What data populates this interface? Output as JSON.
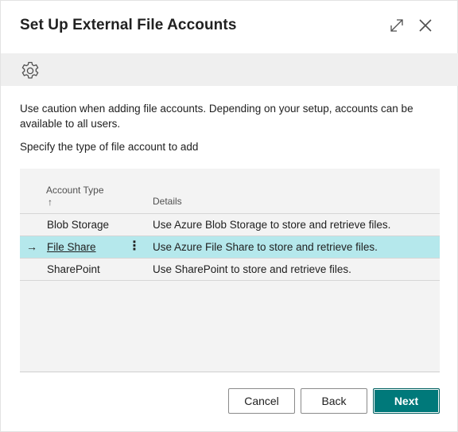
{
  "dialog": {
    "title": "Set Up External File Accounts"
  },
  "icons": {
    "expand": "expand-icon",
    "close": "close-icon",
    "settings": "gear-icon"
  },
  "body": {
    "caution": "Use caution when adding file accounts. Depending on your setup, accounts can be available to all users.",
    "instruction": "Specify the type of file account to add"
  },
  "grid": {
    "columns": {
      "account_type": "Account Type",
      "sort_indicator": "↑",
      "details": "Details"
    },
    "rows": [
      {
        "type": "Blob Storage",
        "details": "Use Azure Blob Storage to store and retrieve files.",
        "selected": false
      },
      {
        "type": "File Share",
        "details": "Use Azure File Share to store and retrieve files.",
        "selected": true,
        "row_indicator": "→",
        "menu": "⋮"
      },
      {
        "type": "SharePoint",
        "details": "Use SharePoint to store and retrieve files.",
        "selected": false
      }
    ]
  },
  "buttons": {
    "cancel": "Cancel",
    "back": "Back",
    "next": "Next"
  },
  "colors": {
    "accent": "#00797a",
    "selected_row": "#b5e8ec",
    "action_bar": "#efefef"
  }
}
